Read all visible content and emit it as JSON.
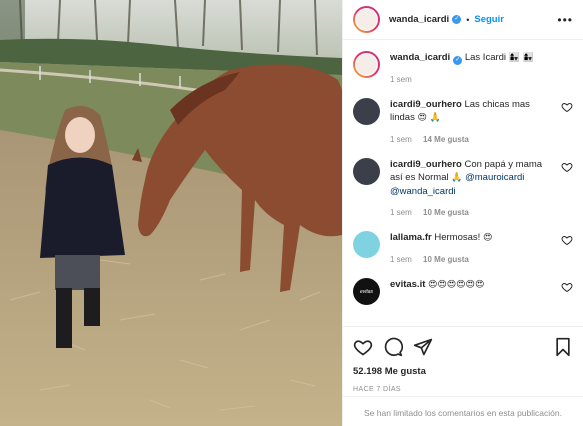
{
  "header": {
    "username": "wanda_icardi",
    "dot": "•",
    "follow_label": "Seguir",
    "more_icon": "more-horizontal-icon"
  },
  "caption": {
    "username": "wanda_icardi",
    "text": "Las Icardi",
    "emojis": "👩‍👧 👩‍👧",
    "time": "1 sem"
  },
  "comments": [
    {
      "username": "icardi9_ourhero",
      "text": "Las chicas mas lindas",
      "emojis": "😍 🙏",
      "time": "1 sem",
      "likes": "14 Me gusta"
    },
    {
      "username": "icardi9_ourhero",
      "text": "Con papá y mama así es Normal",
      "emojis": "🙏",
      "mention1": "@mauroicardi",
      "mention2": "@wanda_icardi",
      "time": "1 sem",
      "likes": "10 Me gusta"
    },
    {
      "username": "lallama.fr",
      "text": "Hermosas!",
      "emojis": "😍",
      "time": "1 sem",
      "likes": "10 Me gusta"
    },
    {
      "username": "evitas.it",
      "text": "",
      "emojis": "😍😍😍😍😍😍",
      "avatar_text": "evitas"
    }
  ],
  "actions": {
    "likes": "52.198 Me gusta",
    "ago": "HACE 7 DÍAS"
  },
  "comments_limited": "Se han limitado los comentarios en esta publicación.",
  "colors": {
    "accent": "#0095f6",
    "verified": "#3897f0",
    "muted": "#8e8e8e",
    "text": "#262626"
  }
}
